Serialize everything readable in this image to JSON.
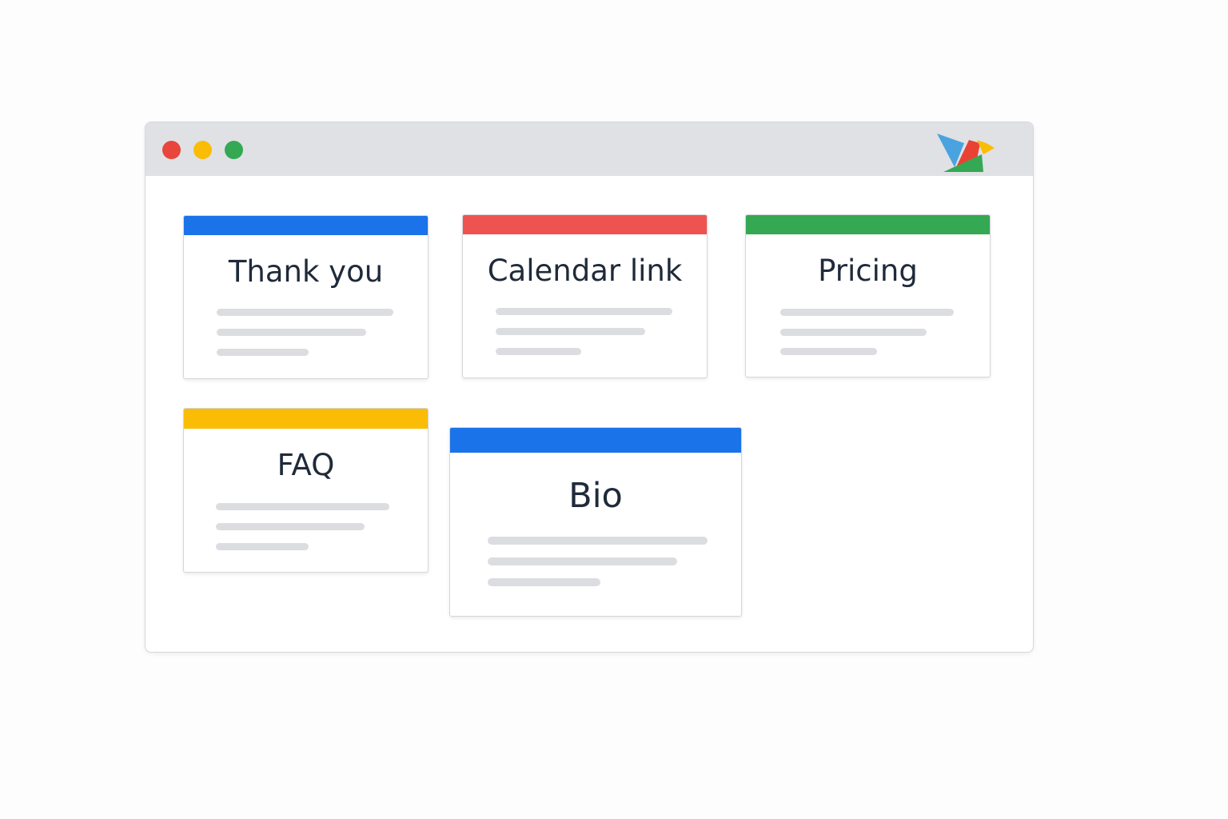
{
  "window": {
    "controls": [
      {
        "name": "close",
        "color": "#e8453c"
      },
      {
        "name": "minimize",
        "color": "#fbbc05"
      },
      {
        "name": "maximize",
        "color": "#34a853"
      }
    ],
    "logo_icon": "bird-logo-icon"
  },
  "cards": [
    {
      "title": "Thank you",
      "accent": "#1a73e8"
    },
    {
      "title": "Calendar link",
      "accent": "#ef5350"
    },
    {
      "title": "Pricing",
      "accent": "#34a853"
    },
    {
      "title": "FAQ",
      "accent": "#fbbc05"
    },
    {
      "title": "Bio",
      "accent": "#1a73e8"
    }
  ]
}
